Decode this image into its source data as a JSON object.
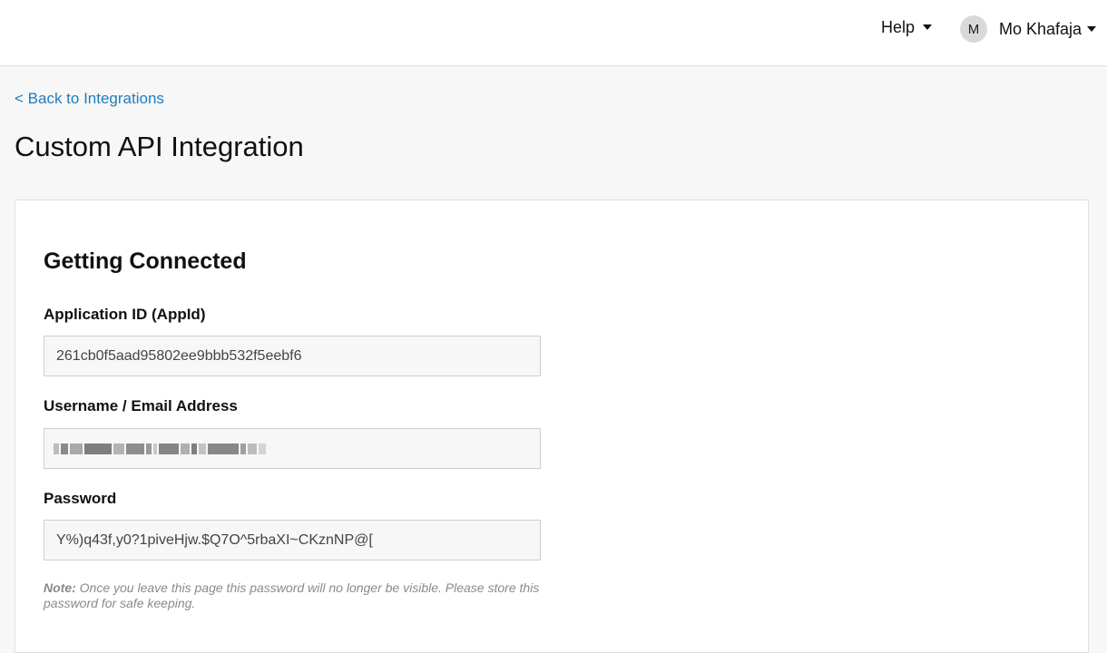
{
  "header": {
    "help_label": "Help",
    "user": {
      "initial": "M",
      "name": "Mo Khafaja"
    }
  },
  "nav": {
    "back_link": "< Back to Integrations"
  },
  "page": {
    "title": "Custom API Integration"
  },
  "card": {
    "heading": "Getting Connected",
    "fields": [
      {
        "label": "Application ID (AppId)",
        "value": "261cb0f5aad95802ee9bbb532f5eebf6"
      },
      {
        "label": "Username / Email Address",
        "value": ""
      },
      {
        "label": "Password",
        "value": "Y%)q43f,y0?1piveHjw.$Q7O^5rbaXI~CKznNP@["
      }
    ],
    "note": {
      "prefix": "Note:",
      "text": " Once you leave this page this password will no longer be visible. Please store this password for safe keeping."
    }
  }
}
